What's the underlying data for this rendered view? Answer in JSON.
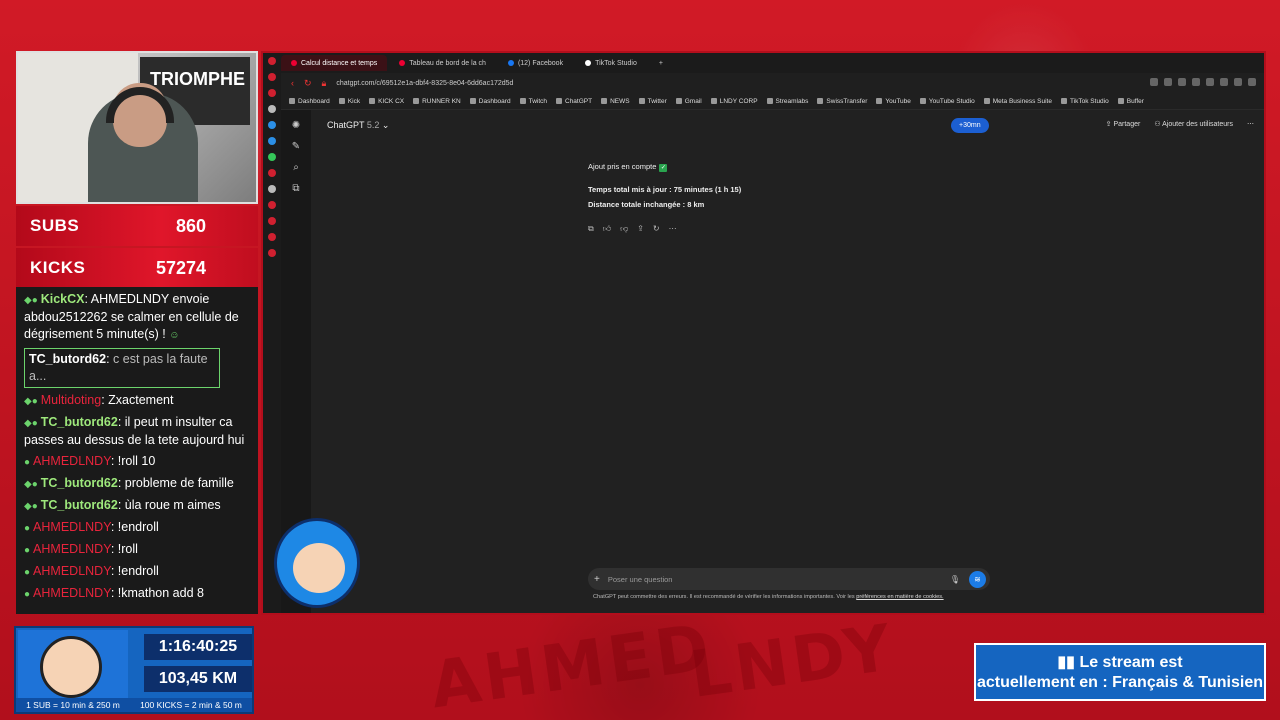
{
  "overlay": {
    "subs_label": "SUBS",
    "subs_value": "860",
    "kicks_label": "KICKS",
    "kicks_value": "57274",
    "timer": "1:16:40:25",
    "distance": "103,45 KM",
    "rule_sub": "1 SUB = 10 min & 250 m",
    "rule_kicks": "100 KICKS = 2 min & 50 m",
    "lang_line1": "Le stream est",
    "lang_line2": "actuellement en : Français & Tunisien",
    "webcam_poster": "TRIOMPHE"
  },
  "chat": {
    "messages": [
      {
        "user": "KickCX",
        "text": "AHMEDLNDY envoie abdou2512262 se calmer en cellule de dégrisement 5 minute(s) !"
      },
      {
        "reply_user": "TC_butord62",
        "reply_text": "c est pas la faute a...",
        "user": "Multidoting",
        "text": "Zxactement"
      },
      {
        "user": "TC_butord62",
        "text": "il peut m insulter ca passes au dessus de la tete aujourd hui"
      },
      {
        "user": "AHMEDLNDY",
        "text": "!roll 10"
      },
      {
        "user": "TC_butord62",
        "text": "probleme de famille"
      },
      {
        "user": "TC_butord62",
        "text": "ùla roue m aimes"
      },
      {
        "user": "AHMEDLNDY",
        "text": "!endroll"
      },
      {
        "user": "AHMEDLNDY",
        "text": "!roll"
      },
      {
        "user": "AHMEDLNDY",
        "text": "!endroll"
      },
      {
        "user": "AHMEDLNDY",
        "text": "!kmathon add 8"
      }
    ]
  },
  "browser": {
    "tabs": [
      {
        "label": "Calcul distance et temps",
        "active": true
      },
      {
        "label": "Tableau de bord de la ch",
        "active": false
      },
      {
        "label": "(12) Facebook",
        "active": false
      },
      {
        "label": "TikTok Studio",
        "active": false
      }
    ],
    "url": "chatgpt.com/c/69512e1a-dbf4-8325-8e04-6dd6ac172d5d",
    "bookmarks": [
      "Dashboard",
      "Kick",
      "KICK CX",
      "RUNNER KN",
      "Dashboard",
      "Twitch",
      "ChatGPT",
      "NEWS",
      "Twitter",
      "Gmail",
      "LNDY CORP",
      "Streamlabs",
      "SwissTransfer",
      "YouTube",
      "YouTube Studio",
      "Meta Business Suite",
      "TikTok Studio",
      "Buffer"
    ]
  },
  "gpt": {
    "model": "ChatGPT",
    "version": "5.2",
    "time_pill": "+30mn",
    "share": "Partager",
    "add_users": "Ajouter des utilisateurs",
    "answer_line1": "Ajout pris en compte",
    "answer_line2": "Temps total mis à jour : 75 minutes (1 h 15)",
    "answer_line3": "Distance totale inchangée : 8 km",
    "placeholder": "Poser une question",
    "disclaimer_text": "ChatGPT peut commettre des erreurs. Il est recommandé de vérifier les informations importantes. Voir les ",
    "disclaimer_link": "préférences en matière de cookies."
  }
}
